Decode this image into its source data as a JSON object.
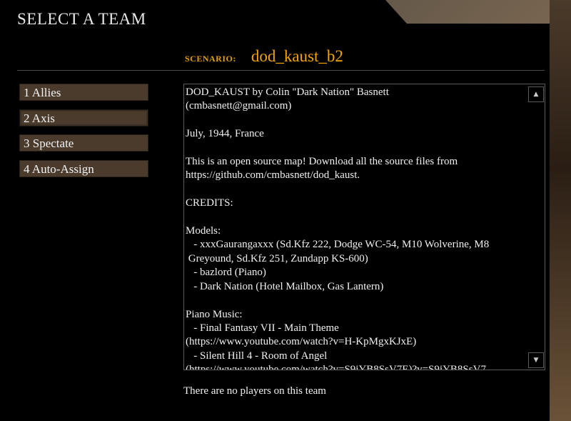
{
  "window": {
    "title": "SELECT A TEAM"
  },
  "scenario": {
    "label": "SCENARIO:",
    "value": "dod_kaust_b2"
  },
  "teams": [
    {
      "label": "1 Allies",
      "selected": false
    },
    {
      "label": "2 Axis",
      "selected": true
    },
    {
      "label": "3 Spectate",
      "selected": false
    },
    {
      "label": "4 Auto-Assign",
      "selected": false
    }
  ],
  "map_info": {
    "text": "DOD_KAUST by Colin \"Dark Nation\" Basnett\n(cmbasnett@gmail.com)\n\nJuly, 1944, France\n\nThis is an open source map! Download all the source files from\nhttps://github.com/cmbasnett/dod_kaust.\n\nCREDITS:\n\nModels:\n   - xxxGaurangaxxx (Sd.Kfz 222, Dodge WC-54, M10 Wolverine, M8\n Greyound, Sd.Kfz 251, Zundapp KS-600)\n   - bazlord (Piano)\n   - Dark Nation (Hotel Mailbox, Gas Lantern)\n\nPiano Music:\n   - Final Fantasy VII - Main Theme\n(https://www.youtube.com/watch?v=H-KpMgxKJxE)\n   - Silent Hill 4 - Room of Angel\n(https://www.youtube.com/watch?v=S9jYB8SsV7E)?v=S9jYB8SsV7"
  },
  "scroll": {
    "up_icon": "▲",
    "down_icon": "▼"
  },
  "status": {
    "text": "There are no players on this team"
  }
}
